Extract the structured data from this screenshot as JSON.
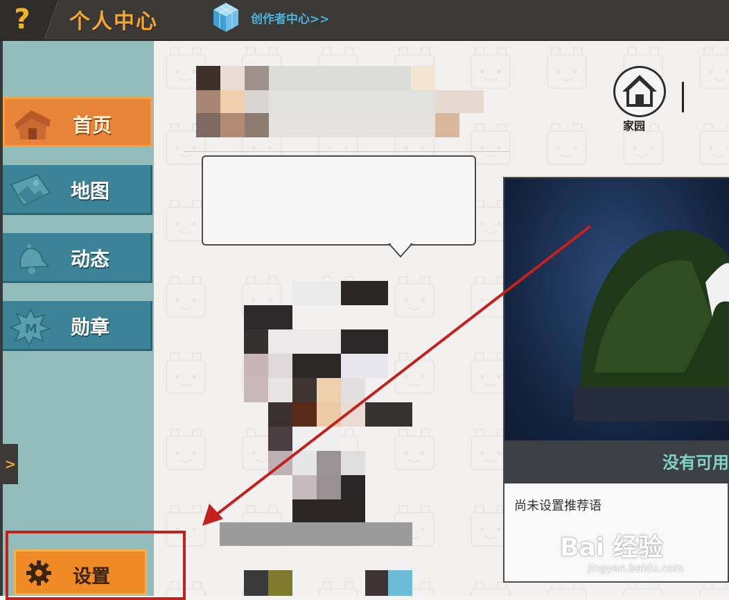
{
  "topbar": {
    "help_icon": "?",
    "title": "个人中心",
    "creator_link": "创作者中心>>"
  },
  "sidebar": {
    "items": [
      {
        "label": "首页",
        "icon": "house-icon",
        "active": true
      },
      {
        "label": "地图",
        "icon": "map-icon",
        "active": false
      },
      {
        "label": "动态",
        "icon": "bell-icon",
        "active": false
      },
      {
        "label": "勋章",
        "icon": "badge-icon",
        "active": false
      }
    ],
    "expand_arrow": ">",
    "settings_label": "设置"
  },
  "profile": {
    "home_label": "家园"
  },
  "card": {
    "status_text": "没有可用",
    "recommend_text": "尚未设置推荐语"
  },
  "watermark": {
    "text": "Bai 经验",
    "sub": "jingyan.baidu.com"
  },
  "colors": {
    "accent_orange": "#e8833a",
    "nav_teal": "#3c8397",
    "sidebar_bg": "#92bdbb",
    "annotation_red": "#c4201d"
  }
}
